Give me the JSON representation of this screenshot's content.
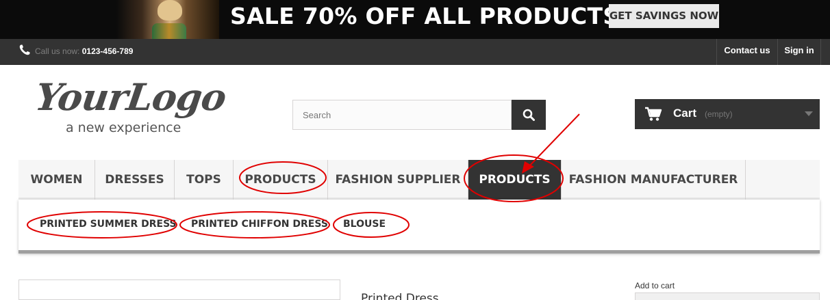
{
  "promo": {
    "headline": "SALE 70% OFF ALL PRODUCTS",
    "button_label": "GET SAVINGS NOW"
  },
  "topbar": {
    "call_prefix": "Call us now:",
    "phone": "0123-456-789",
    "contact_label": "Contact us",
    "signin_label": "Sign in",
    "phone_icon": "phone-icon"
  },
  "logo": {
    "main_text": "YourLogo",
    "tagline": "a new experience"
  },
  "search": {
    "placeholder": "Search",
    "button_icon": "search-icon"
  },
  "cart": {
    "label": "Cart",
    "status": "(empty)",
    "icon": "cart-icon"
  },
  "menu": {
    "items": [
      {
        "label": "WOMEN"
      },
      {
        "label": "DRESSES"
      },
      {
        "label": "TOPS"
      },
      {
        "label": "PRODUCTS"
      },
      {
        "label": "FASHION SUPPLIER"
      },
      {
        "label": "PRODUCTS",
        "active": true
      },
      {
        "label": "FASHION MANUFACTURER"
      }
    ]
  },
  "submenu": {
    "items": [
      {
        "label": "PRINTED SUMMER DRESS"
      },
      {
        "label": "PRINTED CHIFFON DRESS"
      },
      {
        "label": "BLOUSE"
      }
    ]
  },
  "product": {
    "title": "Printed Dress",
    "add_to_cart_label": "Add to cart"
  },
  "colors": {
    "dark": "#333333",
    "menu_bg": "#f6f6f6",
    "annotation_red": "#e00000"
  }
}
